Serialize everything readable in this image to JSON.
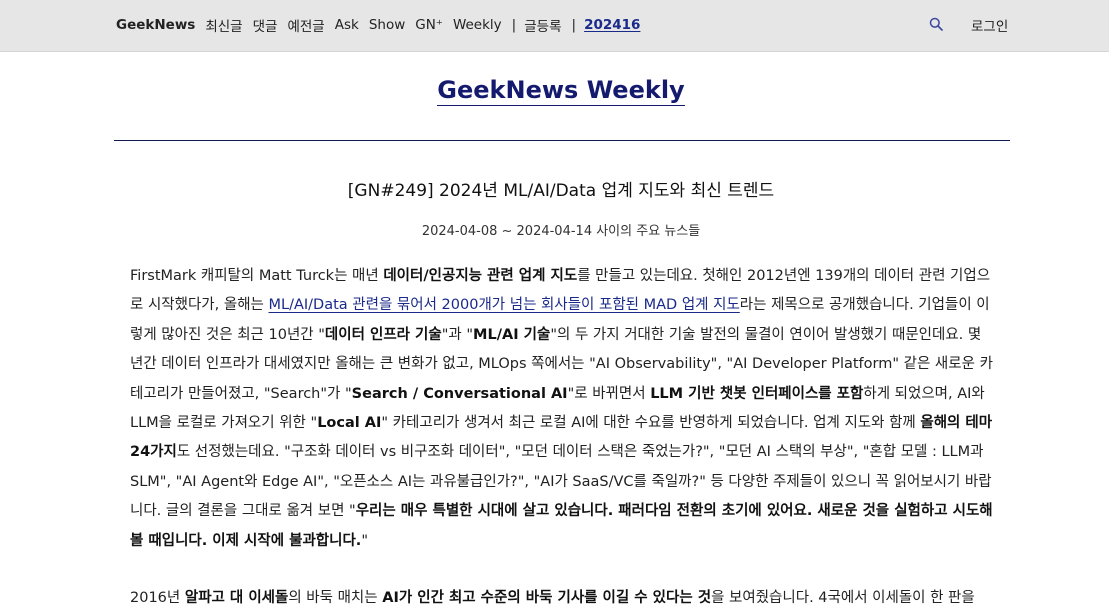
{
  "nav": {
    "brand": "GeekNews",
    "items": [
      "최신글",
      "댓글",
      "예전글",
      "Ask",
      "Show",
      "GN⁺",
      "Weekly"
    ],
    "post": "글등록",
    "current": "202416",
    "login": "로그인",
    "search_icon": "search-icon"
  },
  "masthead": "GeekNews Weekly",
  "article": {
    "title": "[GN#249] 2024년 ML/AI/Data 업계 지도와 최신 트렌드",
    "date_range": "2024-04-08 ~ 2024-04-14 사이의 주요 뉴스들",
    "p1": {
      "s1": "FirstMark 캐피탈의 Matt Turck는 매년 ",
      "b1": "데이터/인공지능 관련 업계 지도",
      "s2": "를 만들고 있는데요. 첫해인 2012년엔 139개의 데이터 관련 기업으로 시작했다가, 올해는 ",
      "link": "ML/AI/Data 관련을 묶어서 2000개가 넘는 회사들이 포함된 MAD 업계 지도",
      "s3": "라는 제목으로 공개했습니다. 기업들이 이렇게 많아진 것은 최근 10년간 \"",
      "b2": "데이터 인프라 기술",
      "s4": "\"과 \"",
      "b3": "ML/AI 기술",
      "s5": "\"의 두 가지 거대한 기술 발전의 물결이 연이어 발생했기 때문인데요. 몇 년간 데이터 인프라가 대세였지만 올해는 큰 변화가 없고, MLOps 쪽에서는 \"AI Observability\", \"AI Developer Platform\" 같은 새로운 카테고리가 만들어졌고, \"Search\"가 \"",
      "b4": "Search / Conversational AI",
      "s6": "\"로 바뀌면서 ",
      "b5": "LLM 기반 챗봇 인터페이스를 포함",
      "s7": "하게 되었으며, AI와 LLM을 로컬로 가져오기 위한 \"",
      "b6": "Local AI",
      "s8": "\" 카테고리가 생겨서 최근 로컬 AI에 대한 수요를 반영하게 되었습니다. 업계 지도와 함께 ",
      "b7": "올해의 테마 24가지",
      "s9": "도 선정했는데요. \"구조화 데이터 vs 비구조화 데이터\", \"모던 데이터 스택은 죽었는가?\", \"모던 AI 스택의 부상\", \"혼합 모델 : LLM과 SLM\", \"AI Agent와 Edge AI\", \"오픈소스 AI는 과유불급인가?\", \"AI가 SaaS/VC를 죽일까?\" 등 다양한 주제들이 있으니 꼭 읽어보시기 바랍니다. 글의 결론을 그대로 옮겨 보면 \"",
      "b8": "우리는 매우 특별한 시대에 살고 있습니다. 패러다임 전환의 초기에 있어요. 새로운 것을 실험하고 시도해 볼 때입니다. 이제 시작에 불과합니다.",
      "s10": "\""
    },
    "p2": {
      "s1": "2016년 ",
      "b1": "알파고 대 이세돌",
      "s2": "의 바둑 매치는 ",
      "b2": "AI가 인간 최고 수준의 바둑 기사를 이길 수 있다는 것",
      "s3": "을 보여줬습니다. 4국에서 이세돌이 한 판을"
    }
  }
}
